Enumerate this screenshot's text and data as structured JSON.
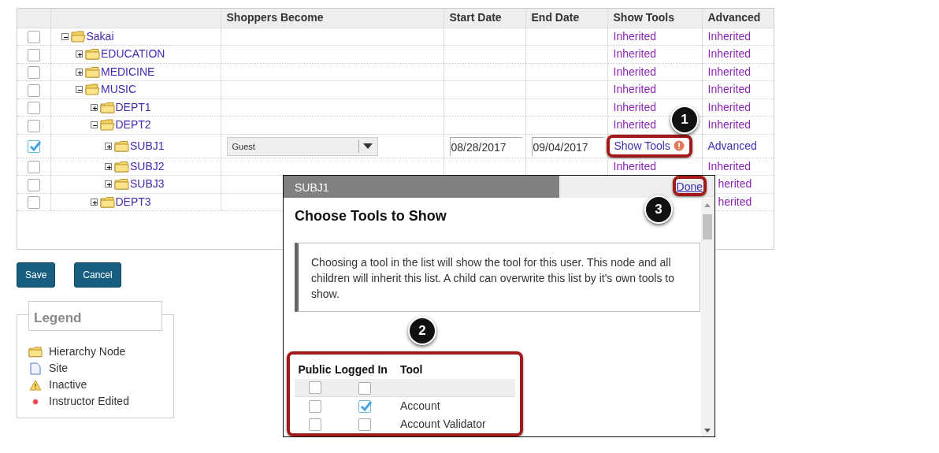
{
  "table": {
    "columns": [
      "Shoppers Become",
      "Start Date",
      "End Date",
      "Show Tools",
      "Advanced"
    ],
    "rows": [
      {
        "label": "Sakai",
        "expanded": true,
        "checked": false,
        "show_tools": "Inherited",
        "advanced": "Inherited",
        "children": [
          {
            "label": "EDUCATION",
            "expanded": false,
            "checked": false,
            "show_tools": "Inherited",
            "advanced": "Inherited"
          },
          {
            "label": "MEDICINE",
            "expanded": false,
            "checked": false,
            "show_tools": "Inherited",
            "advanced": "Inherited"
          },
          {
            "label": "MUSIC",
            "expanded": true,
            "checked": false,
            "show_tools": "Inherited",
            "advanced": "Inherited",
            "children": [
              {
                "label": "DEPT1",
                "expanded": false,
                "checked": false,
                "show_tools": "Inherited",
                "advanced": "Inherited"
              },
              {
                "label": "DEPT2",
                "expanded": true,
                "checked": false,
                "show_tools": "Inherited",
                "advanced": "Inherited",
                "children": [
                  {
                    "label": "SUBJ1",
                    "expanded": false,
                    "checked": true,
                    "shoppers_become": "Guest",
                    "start_date": "08/28/2017",
                    "end_date": "09/04/2017",
                    "show_tools": "Show Tools",
                    "show_tools_alert": true,
                    "advanced": "Advanced"
                  },
                  {
                    "label": "SUBJ2",
                    "expanded": false,
                    "checked": false,
                    "show_tools": "Inherited",
                    "advanced": "Inherited"
                  },
                  {
                    "label": "SUBJ3",
                    "expanded": false,
                    "checked": false,
                    "advanced": "herited",
                    "advanced_clipped": true
                  }
                ]
              },
              {
                "label": "DEPT3",
                "expanded": false,
                "checked": false,
                "advanced": "herited",
                "advanced_clipped": true
              }
            ]
          }
        ]
      }
    ]
  },
  "actions": [
    "Save",
    "Cancel"
  ],
  "legend": {
    "title": "Legend",
    "items": [
      {
        "kind": "folder",
        "label": "Hierarchy Node"
      },
      {
        "kind": "site",
        "label": "Site"
      },
      {
        "kind": "warning",
        "label": "Inactive"
      },
      {
        "kind": "dot",
        "label": "Instructor Edited"
      }
    ]
  },
  "dialog": {
    "title": "SUBJ1",
    "done": "Done",
    "heading": "Choose Tools to Show",
    "info": "Choosing a tool in the list will show the tool for this user. This node and all children will inherit this list. A child can overwrite this list by it's own tools to show.",
    "tool_columns": [
      "Public",
      "Logged In",
      "Tool"
    ],
    "select_all": {
      "public": false,
      "logged_in": false
    },
    "tools": [
      {
        "name": "Account",
        "public": false,
        "logged_in": true
      },
      {
        "name": "Account Validator",
        "public": false,
        "logged_in": false
      }
    ]
  },
  "callouts": [
    {
      "number": "1"
    },
    {
      "number": "2"
    },
    {
      "number": "3"
    }
  ]
}
